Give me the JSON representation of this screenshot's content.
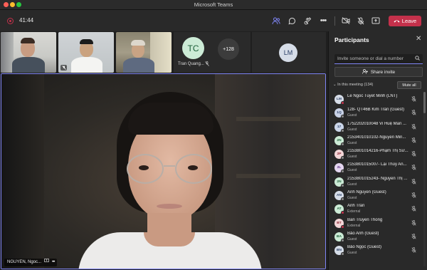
{
  "window": {
    "title": "Microsoft Teams"
  },
  "toolbar": {
    "timer": "41:44",
    "leave_label": "Leave",
    "icons": [
      "people-icon",
      "chat-icon",
      "reactions-icon",
      "more-icon",
      "camera-off-icon",
      "mic-off-icon",
      "share-icon"
    ]
  },
  "stage": {
    "thumbnails": [
      {
        "name": ""
      },
      {
        "name": ""
      },
      {
        "name": ""
      }
    ],
    "tc_tile": {
      "initials": "TC",
      "name": "Tran Quang..."
    },
    "overflow_count": "+128",
    "lm_tile": {
      "initials": "LM"
    },
    "main_video": {
      "name": "NGUYEN, Ngoc..."
    }
  },
  "panel": {
    "title": "Participants",
    "invite_placeholder": "Invite someone or dial a number",
    "share_invite_label": "Share invite",
    "section_label": "In this meeting (134)",
    "mute_all_label": "Mute all",
    "participants": [
      {
        "initials": "LM",
        "name": "Le Ngoc Tuyet Minh (LNT)",
        "role": "",
        "avatar_bg": "#d6dde8",
        "avatar_fg": "#2b3f66",
        "status": "#c4314b"
      },
      {
        "initials": "1Q",
        "name": "128- QT46B Kim Trần (Guest)",
        "role": "Guest",
        "avatar_bg": "#c9d2e6",
        "avatar_fg": "#2b3f66",
        "status": "#8a8a8a"
      },
      {
        "initials": "17",
        "name": "1752202010048 Vi Huệ Mẫn ...",
        "role": "Guest",
        "avatar_bg": "#cbd6ea",
        "avatar_fg": "#2b3f66",
        "status": "#8a8a8a"
      },
      {
        "initials": "2N",
        "name": "2153401010102-Nguyễn Min...",
        "role": "Guest",
        "avatar_bg": "#ccebd6",
        "avatar_fg": "#1c5e38",
        "status": "#8a8a8a"
      },
      {
        "initials": "2P",
        "name": "2153801014216-Phạm Thị Sư...",
        "role": "Guest",
        "avatar_bg": "#f3d6d8",
        "avatar_fg": "#8a2733",
        "status": "#8a8a8a"
      },
      {
        "initials": "2L",
        "name": "2153801015007- Lại Thùy An...",
        "role": "Guest",
        "avatar_bg": "#e4d6f0",
        "avatar_fg": "#5a2d82",
        "status": "#8a8a8a"
      },
      {
        "initials": "2N",
        "name": "2153801015243- Nguyễn Thị ...",
        "role": "Guest",
        "avatar_bg": "#ccebd6",
        "avatar_fg": "#1c5e38",
        "status": "#8a8a8a"
      },
      {
        "initials": "AN",
        "name": "Ánh Nguyễn (Guest)",
        "role": "Guest",
        "avatar_bg": "#d6dde8",
        "avatar_fg": "#2b3f66",
        "status": "#8a8a8a"
      },
      {
        "initials": "AT",
        "name": "Anh Trần",
        "role": "External",
        "avatar_bg": "#ccebd6",
        "avatar_fg": "#1c5e38",
        "status": "#c4314b"
      },
      {
        "initials": "BT",
        "name": "Ban Truyen Thong",
        "role": "External",
        "avatar_bg": "#f3d6d8",
        "avatar_fg": "#8a2733",
        "status": "#c4314b"
      },
      {
        "initials": "BA",
        "name": "Bảo Anh (Guest)",
        "role": "Guest",
        "avatar_bg": "#ccebd6",
        "avatar_fg": "#1c5e38",
        "status": "#8a8a8a"
      },
      {
        "initials": "BN",
        "name": "Bảo Ngọc (Guest)",
        "role": "Guest",
        "avatar_bg": "#d6dde8",
        "avatar_fg": "#2b3f66",
        "status": "#8a8a8a"
      }
    ]
  },
  "colors": {
    "accent": "#7f85f5",
    "leave": "#c4314b"
  }
}
